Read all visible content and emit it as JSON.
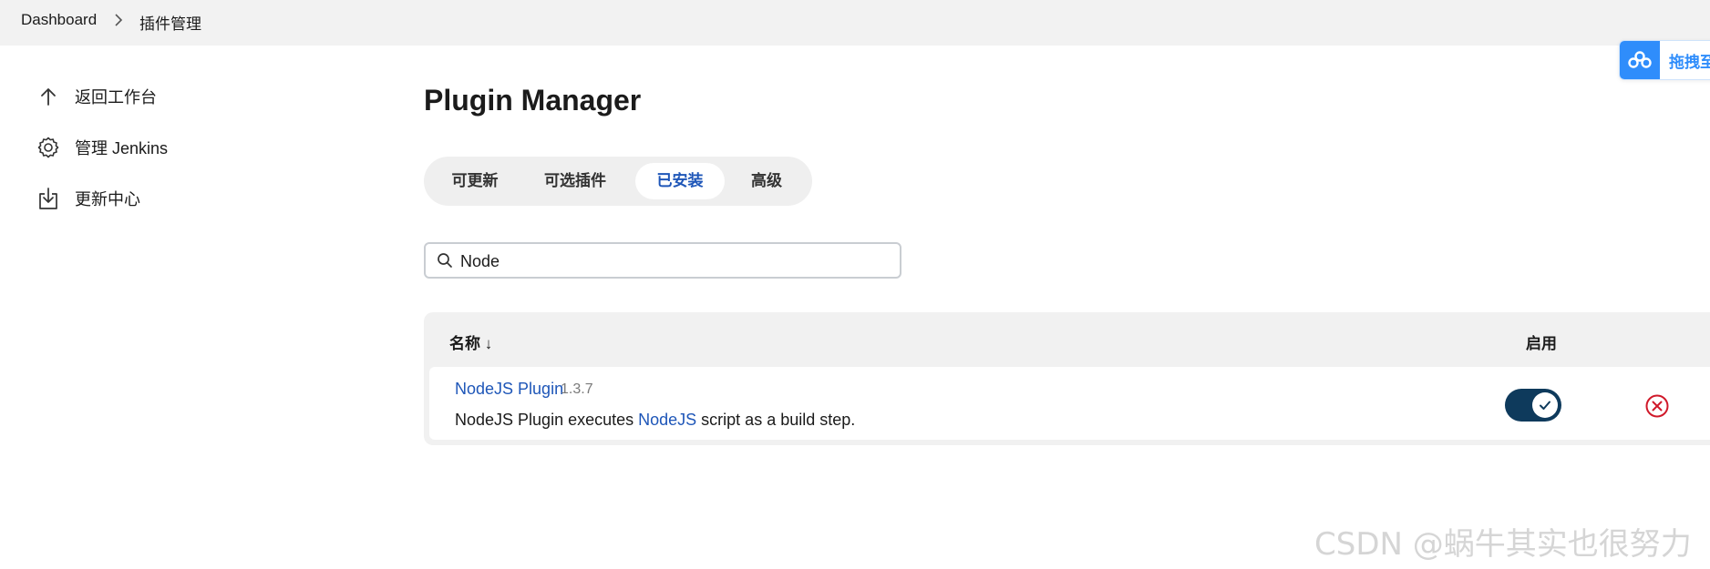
{
  "breadcrumb": {
    "home": "Dashboard",
    "current": "插件管理"
  },
  "sidebar": {
    "items": [
      {
        "label": "返回工作台",
        "icon": "arrow-up-icon"
      },
      {
        "label": "管理 Jenkins",
        "icon": "gear-icon"
      },
      {
        "label": "更新中心",
        "icon": "download-icon"
      }
    ]
  },
  "page": {
    "title": "Plugin Manager"
  },
  "tabs": [
    {
      "label": "可更新",
      "active": false
    },
    {
      "label": "可选插件",
      "active": false
    },
    {
      "label": "已安装",
      "active": true
    },
    {
      "label": "高级",
      "active": false
    }
  ],
  "search": {
    "value": "Node",
    "icon": "search-icon"
  },
  "table": {
    "columns": {
      "name": "名称 ↓",
      "enabled": "启用"
    },
    "rows": [
      {
        "name": "NodeJS Plugin",
        "version": "1.3.7",
        "description_prefix": "NodeJS Plugin executes ",
        "description_link": "NodeJS",
        "description_suffix": " script as a build step.",
        "enabled": true
      }
    ]
  },
  "float_badge": {
    "label": "拖拽至"
  },
  "watermark": "CSDN @蜗牛其实也很努力",
  "colors": {
    "accent": "#1e56b8",
    "toggle_on": "#0e3a5c",
    "danger": "#d0192a",
    "badge": "#2f8dfb"
  }
}
